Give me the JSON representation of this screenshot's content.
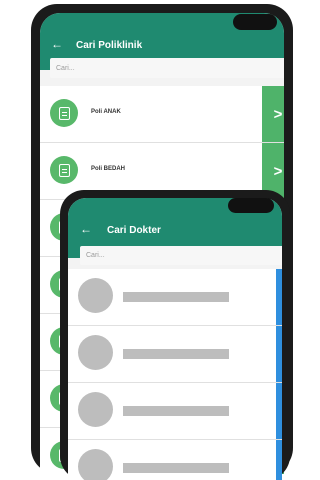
{
  "polyclinic_screen": {
    "title": "Cari Poliklinik",
    "back_icon": "arrow-left-icon",
    "search_placeholder": "Cari...",
    "items": [
      {
        "label": "Poli ANAK"
      },
      {
        "label": "Poli BEDAH"
      },
      {
        "label": ""
      },
      {
        "label": ""
      },
      {
        "label": ""
      },
      {
        "label": ""
      },
      {
        "label": ""
      }
    ],
    "go_glyph": ">"
  },
  "doctor_screen": {
    "title": "Cari Dokter",
    "back_icon": "arrow-left-icon",
    "search_placeholder": "Cari...",
    "rows": 4,
    "go_glyph": ">"
  },
  "colors": {
    "appbar": "#1f8a70",
    "item_icon": "#58b86a",
    "go_button_poly": "#4fb36a",
    "go_button_doctor": "#2f8fde",
    "placeholder_gray": "#bdbdbd"
  }
}
